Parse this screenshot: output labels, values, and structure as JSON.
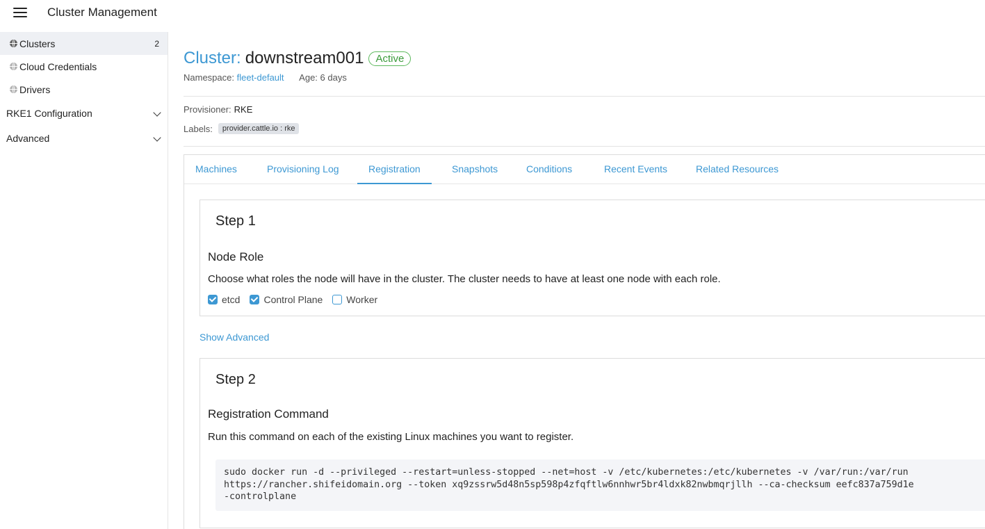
{
  "header": {
    "title": "Cluster Management"
  },
  "sidebar": {
    "items": [
      {
        "label": "Clusters",
        "count": "2",
        "icon": "globe-icon"
      },
      {
        "label": "Cloud Credentials",
        "icon": "globe-icon"
      },
      {
        "label": "Drivers",
        "icon": "globe-icon"
      }
    ],
    "groups": [
      {
        "label": "RKE1 Configuration"
      },
      {
        "label": "Advanced"
      }
    ]
  },
  "cluster": {
    "title_prefix": "Cluster:",
    "name": "downstream001",
    "status": "Active",
    "namespace_label": "Namespace:",
    "namespace": "fleet-default",
    "age": "Age: 6 days",
    "provisioner_label": "Provisioner:",
    "provisioner": "RKE",
    "labels_label": "Labels:",
    "label_chip": "provider.cattle.io : rke"
  },
  "tabs": [
    "Machines",
    "Provisioning Log",
    "Registration",
    "Snapshots",
    "Conditions",
    "Recent Events",
    "Related Resources"
  ],
  "step1": {
    "title": "Step 1",
    "heading": "Node Role",
    "description": "Choose what roles the node will have in the cluster. The cluster needs to have at least one node with each role.",
    "roles": [
      {
        "label": "etcd",
        "checked": true
      },
      {
        "label": "Control Plane",
        "checked": true
      },
      {
        "label": "Worker",
        "checked": false
      }
    ]
  },
  "show_advanced": "Show Advanced",
  "step2": {
    "title": "Step 2",
    "heading": "Registration Command",
    "description": "Run this command on each of the existing Linux machines you want to register.",
    "command_lines": [
      "sudo docker run -d --privileged --restart=unless-stopped --net=host -v /etc/kubernetes:/etc/kubernetes -v /var/run:/var/run",
      "https://rancher.shifeidomain.org --token xq9zssrw5d48n5sp598p4zfqftlw6nnhwr5br4ldxk82nwbmqrjllh --ca-checksum eefc837a759d1e",
      "-controlplane"
    ]
  },
  "colors": {
    "accent": "#3d98d3",
    "active_badge": "#5cb85c"
  }
}
